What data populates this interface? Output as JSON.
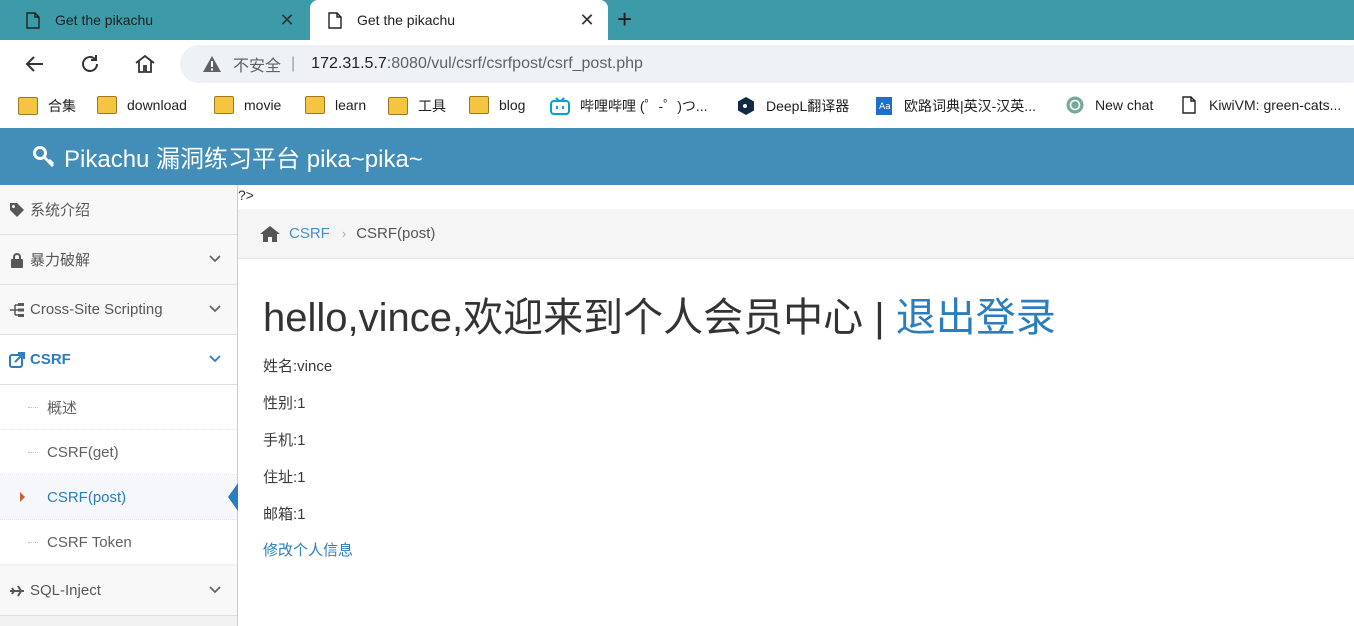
{
  "browser": {
    "tabs": [
      {
        "title": "Get the pikachu",
        "close": "✕"
      },
      {
        "title": "Get the pikachu",
        "close": "✕"
      }
    ],
    "new_tab": "+",
    "omnibox": {
      "security_label": "不安全",
      "separator": "|",
      "host": "172.31.5.7",
      "path": ":8080/vul/csrf/csrfpost/csrf_post.php"
    },
    "bookmarks": [
      {
        "label": "合集",
        "icon": "folder-icon"
      },
      {
        "label": "download",
        "icon": "folder-icon"
      },
      {
        "label": "movie",
        "icon": "folder-icon"
      },
      {
        "label": "learn",
        "icon": "folder-icon"
      },
      {
        "label": "工具",
        "icon": "folder-icon"
      },
      {
        "label": "blog",
        "icon": "folder-icon"
      },
      {
        "label": "哔哩哔哩 (゜-゜)つ...",
        "icon": "bilibili-icon"
      },
      {
        "label": "DeepL翻译器",
        "icon": "deepl-icon"
      },
      {
        "label": "欧路词典|英汉-汉英...",
        "icon": "eudic-icon"
      },
      {
        "label": "New chat",
        "icon": "chatgpt-icon"
      },
      {
        "label": "KiwiVM: green-cats...",
        "icon": "page-icon"
      }
    ]
  },
  "app": {
    "brand": "Pikachu 漏洞练习平台 pika~pika~",
    "colors": {
      "header": "#438eb9",
      "link": "#2b7dbc"
    },
    "sidebar": {
      "items": [
        {
          "label": "系统介绍",
          "icon": "tags-icon"
        },
        {
          "label": "暴力破解",
          "icon": "lock-icon"
        },
        {
          "label": "Cross-Site Scripting",
          "icon": "sitemap-icon"
        },
        {
          "label": "CSRF",
          "icon": "share-icon"
        },
        {
          "label": "SQL-Inject",
          "icon": "plane-icon"
        }
      ],
      "csrf_sub": [
        {
          "label": "概述"
        },
        {
          "label": "CSRF(get)"
        },
        {
          "label": "CSRF(post)"
        },
        {
          "label": "CSRF Token"
        }
      ]
    },
    "content": {
      "php_tail": "?>",
      "breadcrumb": {
        "link": "CSRF",
        "current": "CSRF(post)"
      },
      "welcome": "hello,vince,欢迎来到个人会员中心",
      "welcome_sep": " | ",
      "logout": "退出登录",
      "fields": [
        "姓名:vince",
        "性别:1",
        "手机:1",
        "住址:1",
        "邮箱:1"
      ],
      "edit_link": "修改个人信息"
    }
  }
}
